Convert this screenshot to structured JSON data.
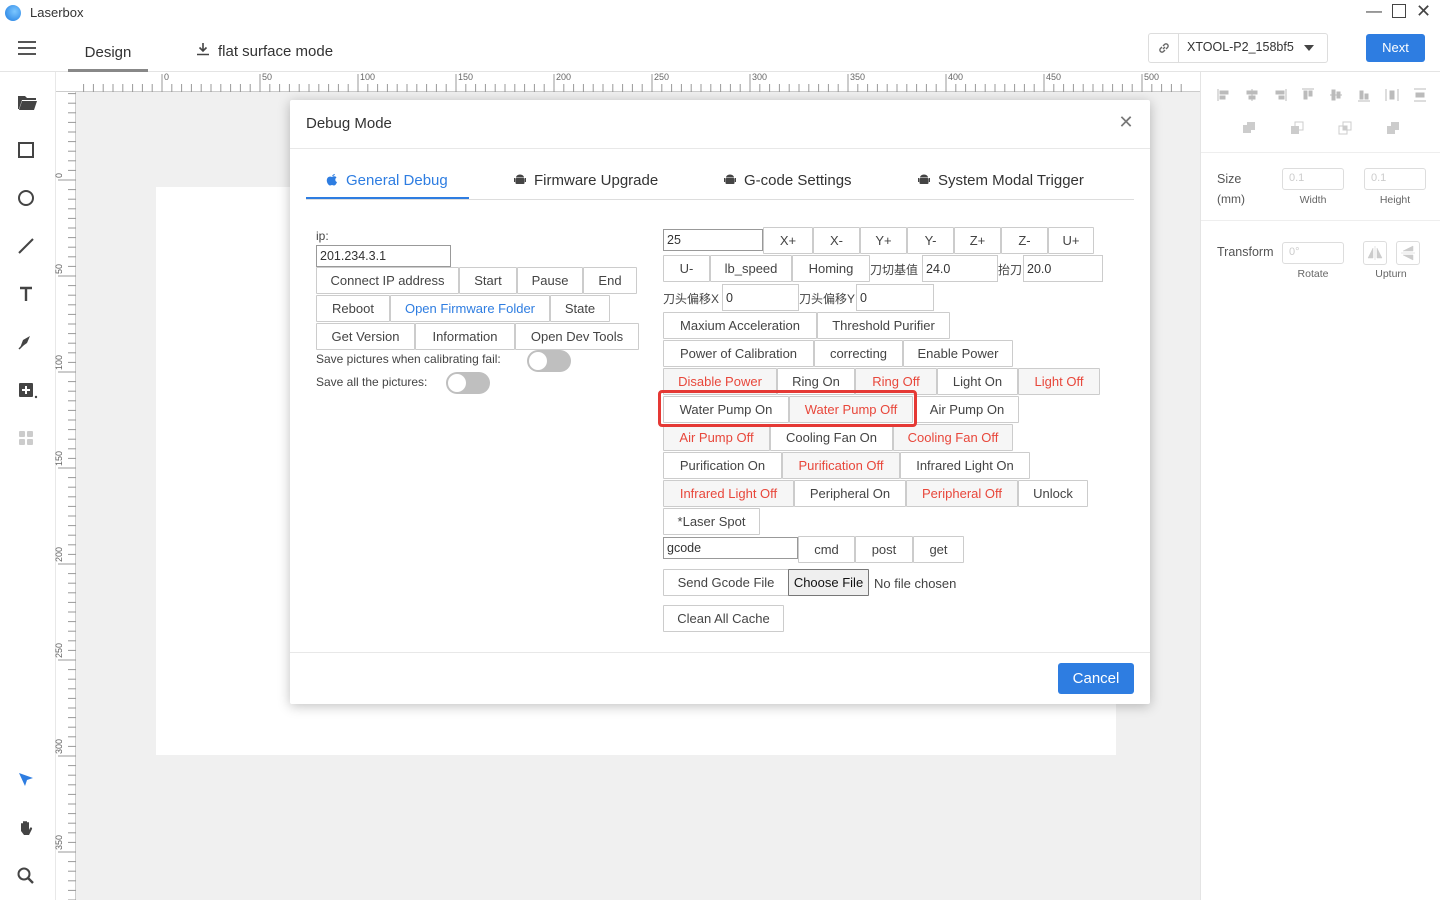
{
  "app": {
    "title": "Laserbox"
  },
  "header": {
    "tabs": [
      "Design",
      "flat surface mode"
    ],
    "device": "XTOOL-P2_158bf5",
    "next_label": "Next"
  },
  "ruler": {
    "top_labels": [
      "0",
      "50",
      "100",
      "150",
      "200",
      "250",
      "300",
      "350",
      "400",
      "450",
      "500"
    ],
    "left_labels": [
      "0",
      "50",
      "100",
      "150",
      "200",
      "250",
      "300",
      "350"
    ]
  },
  "right_panel": {
    "size_label": "Size",
    "size_unit": "(mm)",
    "width_value": "0.1",
    "height_value": "0.1",
    "width_label": "Width",
    "height_label": "Height",
    "transform_label": "Transform",
    "rotate_value": "0°",
    "rotate_label": "Rotate",
    "upturn_label": "Upturn"
  },
  "modal": {
    "title": "Debug Mode",
    "tabs": [
      "General Debug",
      "Firmware Upgrade",
      "G-code Settings",
      "System Modal Trigger"
    ],
    "ip_label": "ip:",
    "ip_value": "201.234.3.1",
    "left_buttons": {
      "connect": "Connect IP address",
      "start": "Start",
      "pause": "Pause",
      "end": "End",
      "reboot": "Reboot",
      "open_firmware": "Open Firmware Folder",
      "state": "State",
      "get_version": "Get Version",
      "information": "Information",
      "open_dev": "Open Dev Tools"
    },
    "save_fail_label": "Save pictures when calibrating fail:",
    "save_all_label": "Save all the pictures:",
    "step_value": "25",
    "axis": {
      "xp": "X+",
      "xm": "X-",
      "yp": "Y+",
      "ym": "Y-",
      "zp": "Z+",
      "zm": "Z-",
      "up": "U+",
      "um": "U-"
    },
    "lb_speed": "lb_speed",
    "homing": "Homing",
    "knife_base_label": "刀切基值",
    "knife_base_value": "24.0",
    "lift_label": "抬刀",
    "lift_value": "20.0",
    "offset_x_label": "刀头偏移X",
    "offset_x_value": "0",
    "offset_y_label": "刀头偏移Y",
    "offset_y_value": "0",
    "right_buttons": {
      "max_acc": "Maxium Acceleration",
      "threshold": "Threshold Purifier",
      "power_cal": "Power of Calibration",
      "correcting": "correcting",
      "enable_power": "Enable Power",
      "disable_power": "Disable Power",
      "ring_on": "Ring On",
      "ring_off": "Ring Off",
      "light_on": "Light On",
      "light_off": "Light Off",
      "water_on": "Water Pump On",
      "water_off": "Water Pump Off",
      "air_on": "Air Pump On",
      "air_off": "Air Pump Off",
      "cool_on": "Cooling Fan On",
      "cool_off": "Cooling Fan Off",
      "pur_on": "Purification On",
      "pur_off": "Purification Off",
      "ir_on": "Infrared Light On",
      "ir_off": "Infrared Light Off",
      "per_on": "Peripheral On",
      "per_off": "Peripheral Off",
      "unlock": "Unlock",
      "laser_spot": "*Laser Spot"
    },
    "gcode_value": "gcode",
    "cmd": "cmd",
    "post": "post",
    "get": "get",
    "send_gcode": "Send Gcode File",
    "choose_file": "Choose File",
    "no_file": "No file chosen",
    "clean_cache": "Clean All Cache",
    "cancel": "Cancel"
  },
  "colors": {
    "accent": "#2e7de1",
    "danger": "#e8473b",
    "highlight": "#e53935"
  }
}
